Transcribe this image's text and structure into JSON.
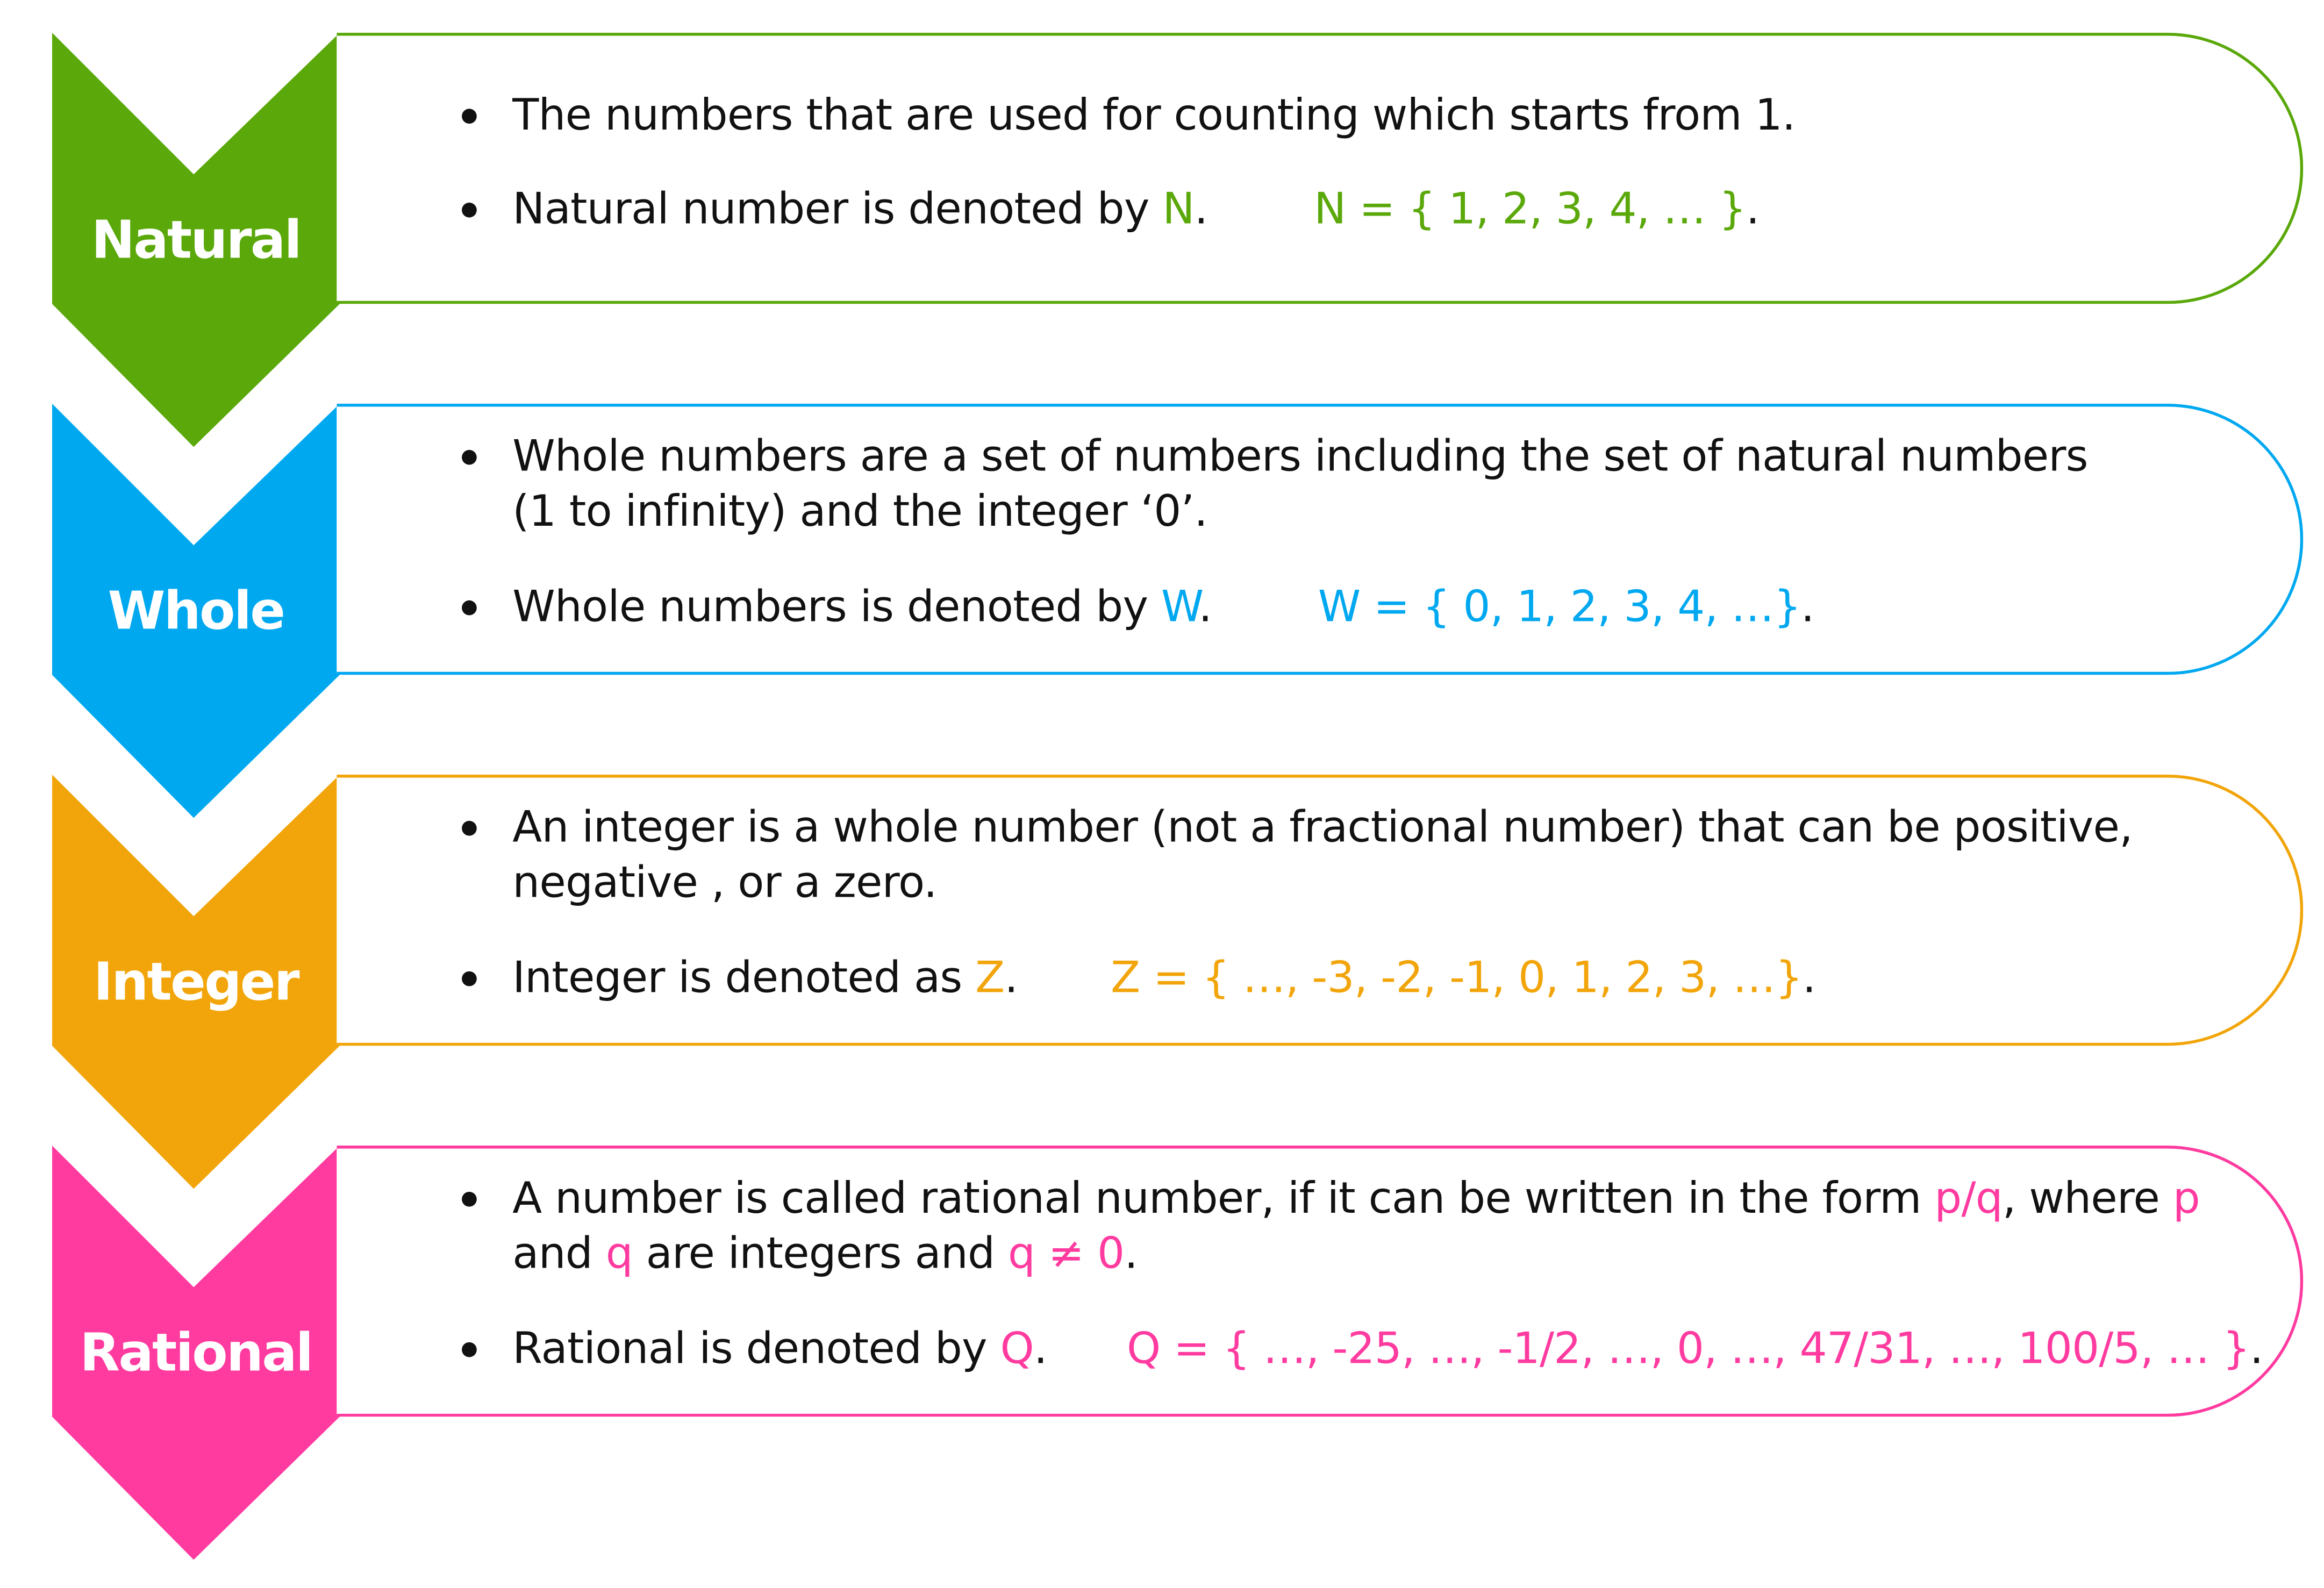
{
  "colors": {
    "natural": "#5aa80a",
    "whole": "#00a8f0",
    "integer": "#f2a50a",
    "rational": "#ff3ba0"
  },
  "rows": [
    {
      "label": "Natural",
      "color": "#5aa80a",
      "bullets": [
        {
          "lines": [
            [
              {
                "t": "The numbers that are used for counting which starts from 1."
              }
            ]
          ]
        },
        {
          "lines": [
            [
              {
                "t": "Natural number is denoted by "
              },
              {
                "t": "N",
                "a": true
              },
              {
                "t": ".        "
              },
              {
                "t": "N = { 1, 2, 3, 4, … }",
                "a": true
              },
              {
                "t": "."
              }
            ]
          ]
        }
      ]
    },
    {
      "label": "Whole",
      "color": "#00a8f0",
      "bullets": [
        {
          "lines": [
            [
              {
                "t": "Whole numbers are a set of numbers including the set of natural numbers"
              }
            ],
            [
              {
                "t": "(1 to infinity) and the integer ‘0’."
              }
            ]
          ]
        },
        {
          "lines": [
            [
              {
                "t": "Whole numbers is denoted by "
              },
              {
                "t": "W",
                "a": true
              },
              {
                "t": ".        "
              },
              {
                "t": "W = { 0, 1, 2, 3, 4, …}",
                "a": true
              },
              {
                "t": "."
              }
            ]
          ]
        }
      ]
    },
    {
      "label": "Integer",
      "color": "#f2a50a",
      "bullets": [
        {
          "lines": [
            [
              {
                "t": "An integer is a whole number (not a fractional number) that can be positive,"
              }
            ],
            [
              {
                "t": "negative , or a zero."
              }
            ]
          ]
        },
        {
          "lines": [
            [
              {
                "t": "Integer is denoted as "
              },
              {
                "t": "Z",
                "a": true
              },
              {
                "t": ".       "
              },
              {
                "t": "Z = { …, -3, -2, -1, 0, 1, 2, 3, …}",
                "a": true
              },
              {
                "t": "."
              }
            ]
          ]
        }
      ]
    },
    {
      "label": "Rational",
      "color": "#ff3ba0",
      "bullets": [
        {
          "lines": [
            [
              {
                "t": "A number is called rational number, if it can be written in the form "
              },
              {
                "t": "p/q",
                "a": true
              },
              {
                "t": ", where "
              },
              {
                "t": "p",
                "a": true
              }
            ],
            [
              {
                "t": "and "
              },
              {
                "t": "q",
                "a": true
              },
              {
                "t": " are integers and "
              },
              {
                "t": "q ≠ 0",
                "a": true
              },
              {
                "t": "."
              }
            ]
          ]
        },
        {
          "lines": [
            [
              {
                "t": "Rational is denoted by "
              },
              {
                "t": "Q",
                "a": true
              },
              {
                "t": ".      "
              },
              {
                "t": "Q = { …, -25, …, -1/2, …, 0, …, 47/31, …, 100/5, … }",
                "a": true
              },
              {
                "t": "."
              }
            ]
          ]
        }
      ]
    }
  ]
}
